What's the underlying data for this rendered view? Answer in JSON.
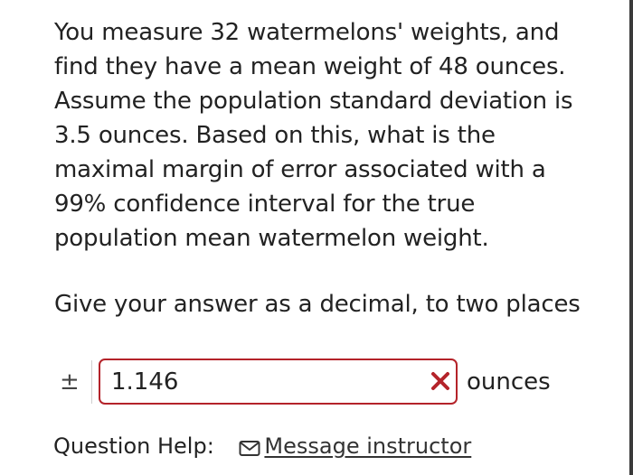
{
  "question": {
    "text": "You measure 32 watermelons' weights, and find they have a mean weight of 48 ounces. Assume the population standard deviation is 3.5 ounces. Based on this, what is the maximal margin of error associated with a 99% confidence interval for the true population mean watermelon weight."
  },
  "instruction": "Give your answer as a decimal, to two places",
  "answer": {
    "prefix_symbol": "±",
    "value": "1.146",
    "status": "incorrect",
    "status_icon": "x-icon",
    "unit": "ounces",
    "error_color": "#b4232a"
  },
  "help": {
    "label": "Question Help:",
    "link_icon": "mail-icon",
    "link_label": "Message instructor"
  }
}
